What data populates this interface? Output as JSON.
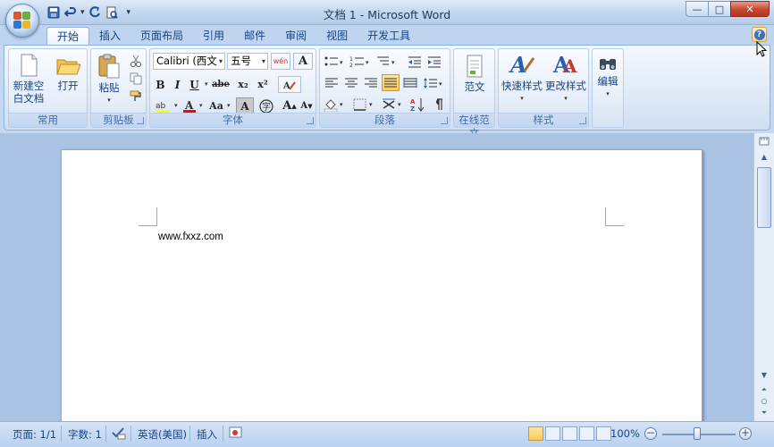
{
  "window": {
    "title": "文档 1 - Microsoft Word",
    "minimize": "—",
    "maximize": "□",
    "close": "✕"
  },
  "qat": {
    "items": [
      "save-icon",
      "undo-icon",
      "redo-icon",
      "print-preview-icon"
    ],
    "more": "▾"
  },
  "tabs": [
    "开始",
    "插入",
    "页面布局",
    "引用",
    "邮件",
    "审阅",
    "视图",
    "开发工具"
  ],
  "active_tab": "开始",
  "help": "?",
  "ribbon": {
    "groups": {
      "common": {
        "label": "常用",
        "new_blank_line1": "新建空",
        "new_blank_line2": "白文档",
        "open": "打开"
      },
      "clipboard": {
        "label": "剪贴板",
        "paste": "粘贴"
      },
      "font": {
        "label": "字体",
        "font_name": "Calibri (西文正",
        "font_size": "五号",
        "bold": "B",
        "italic": "I",
        "underline": "U",
        "strike": "abe",
        "subscript": "x₂",
        "superscript": "x²",
        "change_case": "Aa",
        "grow": "A",
        "shrink": "A",
        "char_shading": "A",
        "enclose": "字",
        "phonetic": "wén",
        "clear_format": "A"
      },
      "paragraph": {
        "label": "段落"
      },
      "template": {
        "label": "在线范文",
        "button": "范文"
      },
      "styles": {
        "label": "样式",
        "quick_styles": "快速样式",
        "change_styles": "更改样式"
      },
      "editing": {
        "button": "编辑"
      }
    }
  },
  "document": {
    "text": "www.fxxz.com"
  },
  "status": {
    "page": "页面: 1/1",
    "words": "字数: 1",
    "language": "英语(美国)",
    "mode": "插入",
    "zoom": "100%"
  },
  "colors": {
    "highlight": "#ffff00",
    "font_color": "#ff0000",
    "accent": "#15428b"
  }
}
